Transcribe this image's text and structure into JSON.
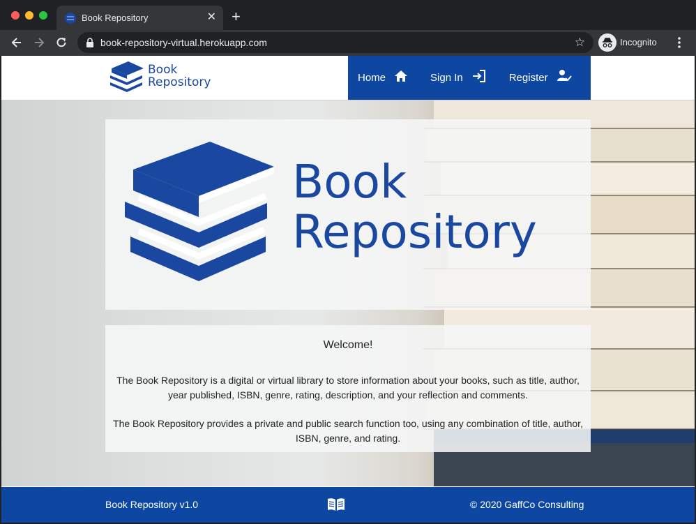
{
  "browser": {
    "tab_title": "Book Repository",
    "url": "book-repository-virtual.herokuapp.com",
    "incognito_label": "Incognito"
  },
  "header": {
    "brand_line1": "Book",
    "brand_line2": "Repository",
    "nav": [
      {
        "label": "Home",
        "icon": "home-icon"
      },
      {
        "label": "Sign In",
        "icon": "sign-in-icon"
      },
      {
        "label": "Register",
        "icon": "register-icon"
      }
    ]
  },
  "hero": {
    "logo_line1": "Book",
    "logo_line2": "Repository",
    "welcome_title": "Welcome!",
    "paragraph1": "The Book Repository is a digital or virtual library to store information about your books, such as title, author, year published, ISBN, genre, rating, description, and your reflection and comments.",
    "paragraph2": "The Book Repository provides a private and public search function too, using any combination of title, author, ISBN, genre, and rating."
  },
  "footer": {
    "left": "Book Repository v1.0",
    "icon": "open-book-icon",
    "right": "© 2020 GaffCo Consulting"
  },
  "colors": {
    "brand_blue": "#0d47a1",
    "logo_blue": "#1a47a0"
  }
}
